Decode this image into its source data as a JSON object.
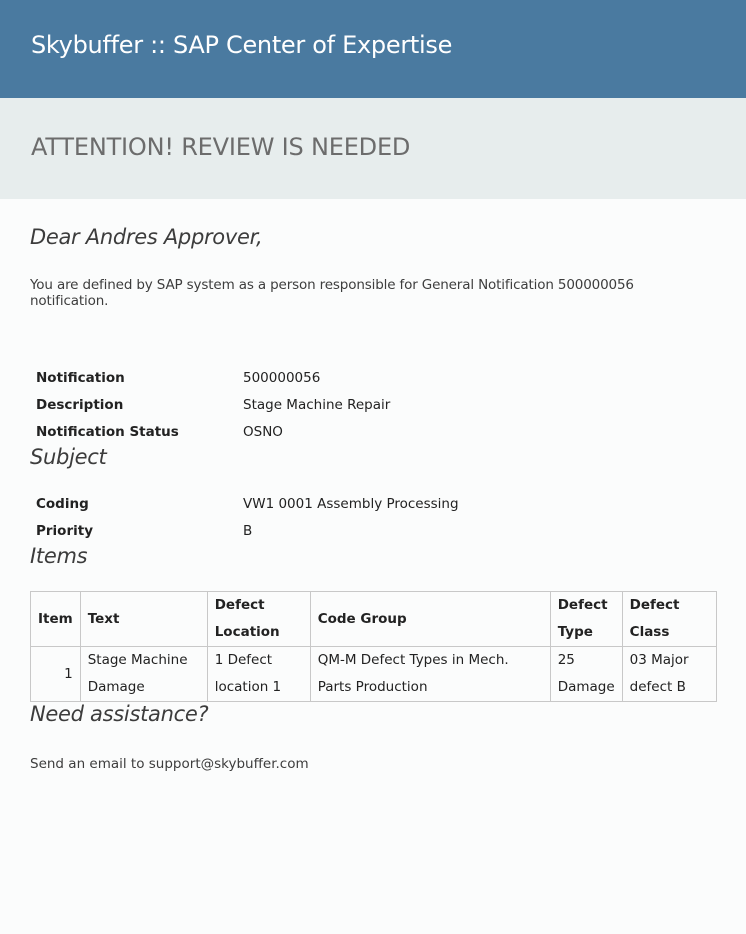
{
  "header": {
    "title": "Skybuffer :: SAP Center of Expertise"
  },
  "banner": {
    "text": "ATTENTION! REVIEW IS NEEDED"
  },
  "greeting": "Dear Andres Approver,",
  "intro": "You are defined by SAP system as a person responsible for General Notification 500000056 notification.",
  "notification": {
    "rows": [
      {
        "label": "Notification",
        "value": "500000056"
      },
      {
        "label": "Description",
        "value": "Stage Machine Repair"
      },
      {
        "label": "Notification Status",
        "value": "OSNO"
      }
    ]
  },
  "subject": {
    "title": "Subject",
    "rows": [
      {
        "label": "Coding",
        "value": "VW1 0001 Assembly Processing"
      },
      {
        "label": "Priority",
        "value": "B"
      }
    ]
  },
  "items": {
    "title": "Items",
    "columns": [
      "Item",
      "Text",
      "Defect Location",
      "Code Group",
      "Defect Type",
      "Defect Class"
    ],
    "rows": [
      [
        "1",
        "Stage Machine Damage",
        "1 Defect location 1",
        "QM-M Defect Types in Mech. Parts Production",
        "25 Damage",
        "03 Major defect B"
      ]
    ]
  },
  "assistance": {
    "title": "Need assistance?",
    "text": "Send an email to support@skybuffer.com"
  },
  "colors": {
    "header_bg": "#4a7aa0",
    "banner_bg": "#e7eded",
    "page_bg": "#fbfcfc"
  }
}
